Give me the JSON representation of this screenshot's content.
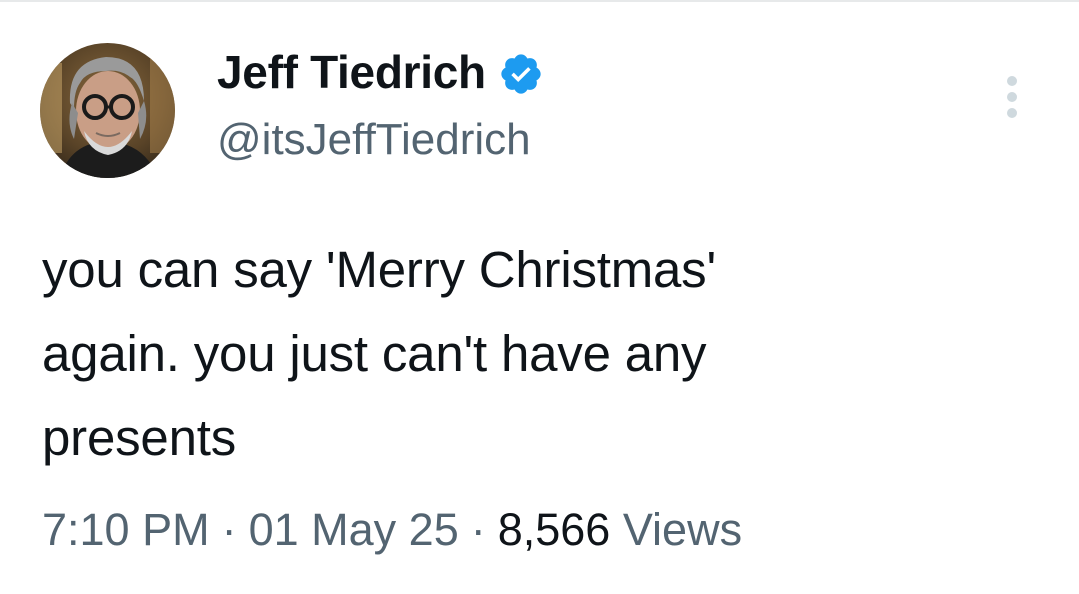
{
  "author": {
    "display_name": "Jeff Tiedrich",
    "handle": "@itsJeffTiedrich",
    "verified_color": "#1d9bf0",
    "avatar_icon": "user-avatar-photo",
    "verified_icon": "verified-badge-icon"
  },
  "tweet": {
    "lines": [
      "you can say 'Merry Christmas'",
      "again. you just can't have any",
      "presents"
    ]
  },
  "meta": {
    "time": "7:10 PM",
    "date": "01 May 25",
    "separator": "·",
    "views_count": "8,566",
    "views_label": "Views"
  },
  "menu": {
    "icon": "more-options-icon"
  },
  "colors": {
    "text_primary": "#0f1419",
    "text_secondary": "#536471",
    "divider": "#e7e9ea"
  }
}
